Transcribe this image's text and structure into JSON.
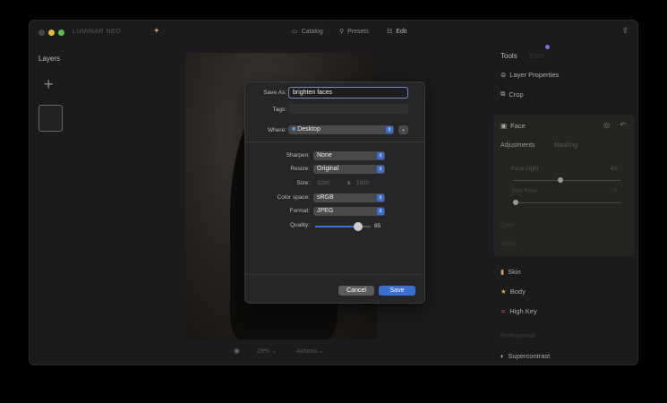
{
  "app": {
    "name": "LUMINAR NEO"
  },
  "nav": {
    "catalog": "Catalog",
    "presets": "Presets",
    "edit": "Edit"
  },
  "layers": {
    "title": "Layers",
    "add": "+"
  },
  "canvas_bar": {
    "zoom": "29%",
    "actions": "Actions"
  },
  "dialog": {
    "save_as_label": "Save As:",
    "save_as_value": "brighten faces",
    "tags_label": "Tags:",
    "tags_value": "",
    "where_label": "Where:",
    "where_value": "Desktop",
    "sharpen_label": "Sharpen:",
    "sharpen_value": "None",
    "resize_label": "Resize:",
    "resize_value": "Original",
    "size_label": "Size:",
    "width": "1280",
    "x": "x",
    "height": "1920",
    "colorspace_label": "Color space:",
    "colorspace_value": "sRGB",
    "format_label": "Format:",
    "format_value": "JPEG",
    "quality_label": "Quality:",
    "quality_value": "85",
    "cancel": "Cancel",
    "save": "Save"
  },
  "tools": {
    "title": "Tools",
    "edits": "Edits",
    "layer_properties": "Layer Properties",
    "crop": "Crop",
    "face": {
      "title": "Face",
      "tab_adjustments": "Adjustments",
      "tab_masking": "Masking",
      "face_light_label": "Face Light",
      "face_light_value": "43",
      "slim_face_label": "Slim Face",
      "slim_face_value": "0",
      "eyes": "Eyes",
      "mouth": "Mouth"
    },
    "skin": "Skin",
    "body": "Body",
    "high_key": "High Key",
    "professional": "Professional",
    "supercontrast": "Supercontrast"
  }
}
